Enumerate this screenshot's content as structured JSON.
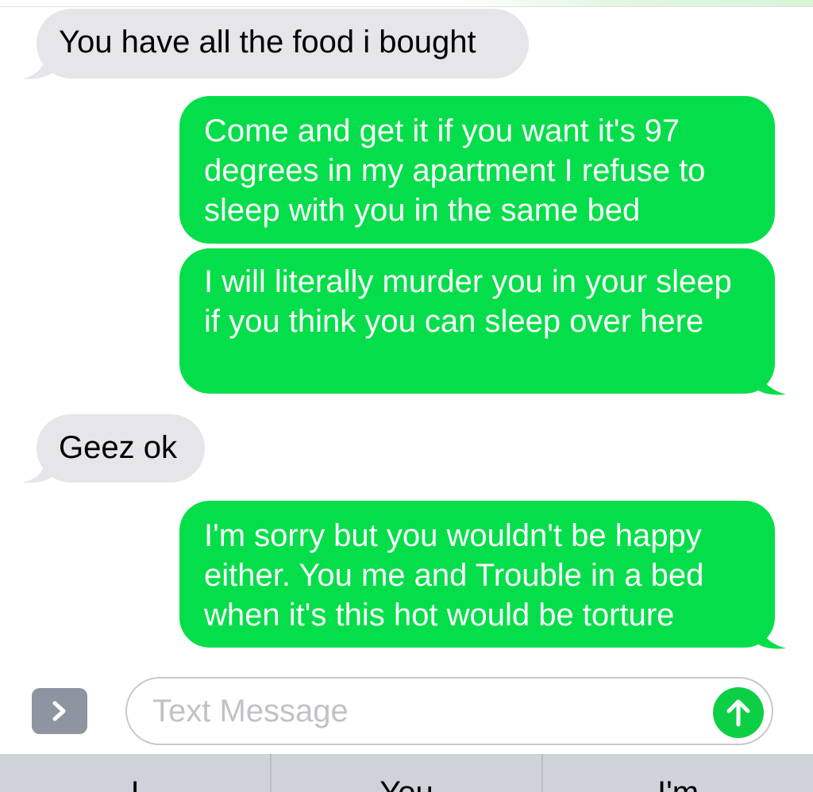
{
  "messages": [
    {
      "direction": "incoming",
      "text": "You have all the food i bought"
    },
    {
      "direction": "outgoing",
      "text": "Come and get it if you want it's 97 degrees in my apartment I refuse to sleep with you in the same bed"
    },
    {
      "direction": "outgoing",
      "text": "I will literally murder you in your sleep if you think you can sleep over here"
    },
    {
      "direction": "incoming",
      "text": "Geez ok"
    },
    {
      "direction": "outgoing",
      "text": "I'm sorry but you wouldn't be happy either. You me and Trouble in a bed when it's this hot would be torture"
    }
  ],
  "composer": {
    "placeholder": "Text Message",
    "apps_icon": "chevron-right-icon",
    "send_icon": "arrow-up-icon"
  },
  "suggestions": [
    "I",
    "You",
    "I'm"
  ],
  "colors": {
    "outgoing_bubble": "#04de4a",
    "incoming_bubble": "#e5e5ea",
    "send_button": "#0ccf45",
    "keyboard_bar": "#ced2d9"
  }
}
